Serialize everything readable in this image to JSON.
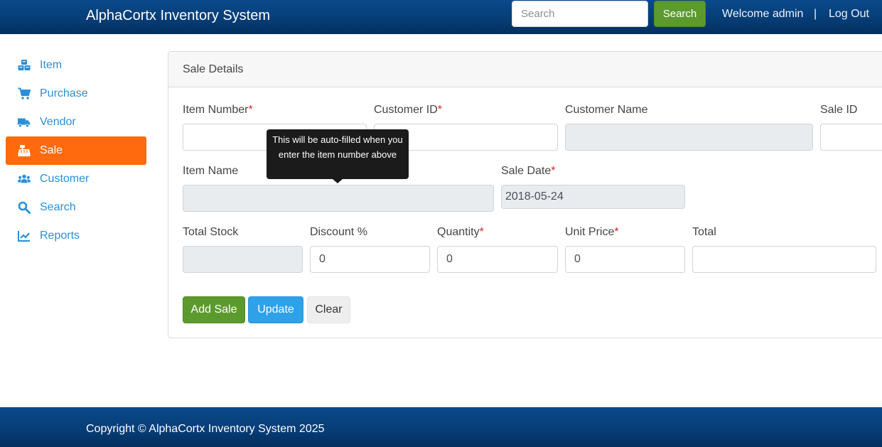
{
  "header": {
    "brand": "AlphaCortx Inventory System",
    "search_placeholder": "Search",
    "search_button": "Search",
    "welcome": "Welcome admin",
    "separator": "|",
    "logout": "Log Out"
  },
  "sidebar": {
    "items": [
      {
        "label": "Item",
        "icon": "cubes-icon"
      },
      {
        "label": "Purchase",
        "icon": "cart-icon"
      },
      {
        "label": "Vendor",
        "icon": "truck-icon"
      },
      {
        "label": "Sale",
        "icon": "cash-register-icon",
        "active": true
      },
      {
        "label": "Customer",
        "icon": "users-icon"
      },
      {
        "label": "Search",
        "icon": "search-icon"
      },
      {
        "label": "Reports",
        "icon": "chart-line-icon"
      }
    ]
  },
  "card": {
    "title": "Sale Details",
    "required_mark": "*",
    "fields": {
      "item_number": {
        "label": "Item Number",
        "value": ""
      },
      "customer_id": {
        "label": "Customer ID",
        "value": ""
      },
      "customer_name": {
        "label": "Customer Name",
        "value": ""
      },
      "sale_id": {
        "label": "Sale ID",
        "value": ""
      },
      "item_name": {
        "label": "Item Name",
        "value": ""
      },
      "sale_date": {
        "label": "Sale Date",
        "value": "2018-05-24"
      },
      "total_stock": {
        "label": "Total Stock",
        "value": ""
      },
      "discount": {
        "label": "Discount %",
        "value": "0"
      },
      "quantity": {
        "label": "Quantity",
        "value": "0"
      },
      "unit_price": {
        "label": "Unit Price",
        "value": "0"
      },
      "total": {
        "label": "Total",
        "value": ""
      }
    },
    "tooltip": "This will be auto-filled when you enter the item number above",
    "buttons": {
      "add": "Add Sale",
      "update": "Update",
      "clear": "Clear"
    }
  },
  "footer": {
    "copyright": "Copyright © AlphaCortx Inventory System 2025"
  },
  "colors": {
    "header": "#063c74",
    "active_nav": "#ff6a0e",
    "link": "#2a8fd6",
    "success": "#5c9a2e",
    "info": "#2ea1e8",
    "required": "#d9232d"
  }
}
